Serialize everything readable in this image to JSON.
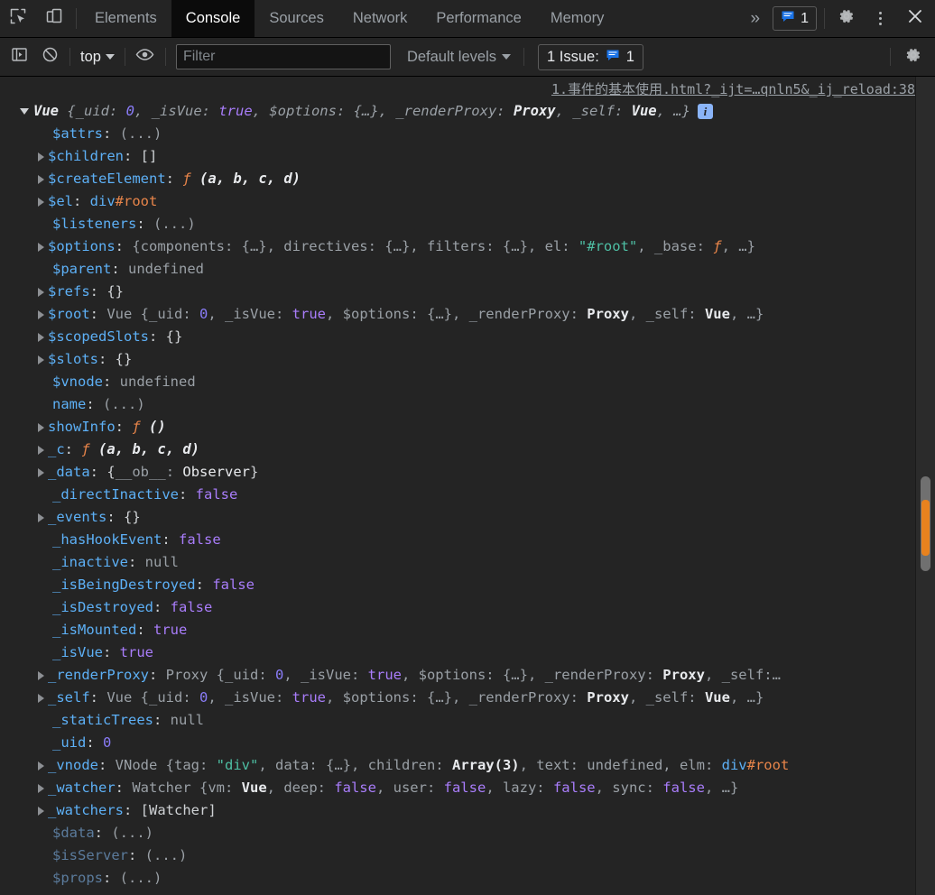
{
  "window": {
    "title": "Chrome DevTools",
    "theme": "dark"
  },
  "tabbar": {
    "inspect_icon": "inspect-element-icon",
    "device_icon": "device-toolbar-icon",
    "tabs": [
      {
        "label": "Elements",
        "active": false
      },
      {
        "label": "Console",
        "active": true
      },
      {
        "label": "Sources",
        "active": false
      },
      {
        "label": "Network",
        "active": false
      },
      {
        "label": "Performance",
        "active": false
      },
      {
        "label": "Memory",
        "active": false
      }
    ],
    "more_tabs_label": "»",
    "issues_chip": {
      "icon": "issues-message-icon",
      "count": "1"
    },
    "settings_icon": "gear-icon",
    "more_options_icon": "kebab-menu-icon",
    "close_icon": "close-icon"
  },
  "filterbar": {
    "sidebar_toggle_icon": "console-sidebar-icon",
    "clear_icon": "clear-console-icon",
    "context": {
      "value": "top"
    },
    "eye_icon": "live-expression-icon",
    "filter": {
      "placeholder": "Filter",
      "value": ""
    },
    "levels": {
      "value": "Default levels"
    },
    "issue_badge": {
      "label": "1 Issue:",
      "icon": "issues-message-icon",
      "count": "1"
    },
    "settings_icon": "console-settings-icon"
  },
  "console": {
    "source_link": "1.事件的基本使用.html?_ijt=…qnln5&_ij_reload:38",
    "info_badge": "i",
    "header": {
      "tokens": [
        {
          "t": "Vue ",
          "c": "t-ital-w"
        },
        {
          "t": "{_uid: ",
          "c": "t-ital"
        },
        {
          "t": "0",
          "c": "t-ital-b"
        },
        {
          "t": ", _isVue: ",
          "c": "t-ital"
        },
        {
          "t": "true",
          "c": "t-ital-p"
        },
        {
          "t": ", $options: {…}, _renderProxy: ",
          "c": "t-ital"
        },
        {
          "t": "Proxy",
          "c": "t-ital-w"
        },
        {
          "t": ", _self: ",
          "c": "t-ital"
        },
        {
          "t": "Vue",
          "c": "t-ital-w"
        },
        {
          "t": ", …}",
          "c": "t-ital"
        }
      ]
    },
    "rows": [
      {
        "arrow": "none",
        "key": "$attrs",
        "keyclass": "k-prop",
        "tokens": [
          {
            "t": ": ",
            "c": "t-punc"
          },
          {
            "t": "(...)",
            "c": "t-dim"
          }
        ]
      },
      {
        "arrow": "closed",
        "key": "$children",
        "keyclass": "k-prop",
        "tokens": [
          {
            "t": ": ",
            "c": "t-punc"
          },
          {
            "t": "[]",
            "c": "t-punc"
          }
        ]
      },
      {
        "arrow": "closed",
        "key": "$createElement",
        "keyclass": "k-prop",
        "tokens": [
          {
            "t": ": ",
            "c": "t-punc"
          },
          {
            "t": "ƒ ",
            "c": "t-fn"
          },
          {
            "t": "(a, b, c, d)",
            "c": "t-ital-w"
          }
        ]
      },
      {
        "arrow": "closed",
        "key": "$el",
        "keyclass": "k-prop",
        "tokens": [
          {
            "t": ": ",
            "c": "t-punc"
          },
          {
            "t": "div",
            "c": "t-node"
          },
          {
            "t": "#root",
            "c": "t-nodeid"
          }
        ]
      },
      {
        "arrow": "none",
        "key": "$listeners",
        "keyclass": "k-prop",
        "tokens": [
          {
            "t": ": ",
            "c": "t-punc"
          },
          {
            "t": "(...)",
            "c": "t-dim"
          }
        ]
      },
      {
        "arrow": "closed",
        "key": "$options",
        "keyclass": "k-prop",
        "tokens": [
          {
            "t": ": ",
            "c": "t-punc"
          },
          {
            "t": "{components: {…}, directives: {…}, filters: {…}, el: ",
            "c": "t-dim"
          },
          {
            "t": "\"#root\"",
            "c": "t-str"
          },
          {
            "t": ", _base: ",
            "c": "t-dim"
          },
          {
            "t": "ƒ",
            "c": "t-fn"
          },
          {
            "t": ", …}",
            "c": "t-dim"
          }
        ]
      },
      {
        "arrow": "none",
        "key": "$parent",
        "keyclass": "k-prop",
        "tokens": [
          {
            "t": ": ",
            "c": "t-punc"
          },
          {
            "t": "undefined",
            "c": "t-dim"
          }
        ]
      },
      {
        "arrow": "closed",
        "key": "$refs",
        "keyclass": "k-prop",
        "tokens": [
          {
            "t": ": ",
            "c": "t-punc"
          },
          {
            "t": "{}",
            "c": "t-punc"
          }
        ]
      },
      {
        "arrow": "closed",
        "key": "$root",
        "keyclass": "k-prop",
        "tokens": [
          {
            "t": ": ",
            "c": "t-punc"
          },
          {
            "t": "Vue ",
            "c": "t-dim"
          },
          {
            "t": "{_uid: ",
            "c": "t-dim"
          },
          {
            "t": "0",
            "c": "t-num"
          },
          {
            "t": ", _isVue: ",
            "c": "t-dim"
          },
          {
            "t": "true",
            "c": "t-bool"
          },
          {
            "t": ", $options: {…}, _renderProxy: ",
            "c": "t-dim"
          },
          {
            "t": "Proxy",
            "c": "t-ctor"
          },
          {
            "t": ", _self: ",
            "c": "t-dim"
          },
          {
            "t": "Vue",
            "c": "t-ctor"
          },
          {
            "t": ", …}",
            "c": "t-dim"
          }
        ]
      },
      {
        "arrow": "closed",
        "key": "$scopedSlots",
        "keyclass": "k-prop",
        "tokens": [
          {
            "t": ": ",
            "c": "t-punc"
          },
          {
            "t": "{}",
            "c": "t-punc"
          }
        ]
      },
      {
        "arrow": "closed",
        "key": "$slots",
        "keyclass": "k-prop",
        "tokens": [
          {
            "t": ": ",
            "c": "t-punc"
          },
          {
            "t": "{}",
            "c": "t-punc"
          }
        ]
      },
      {
        "arrow": "none",
        "key": "$vnode",
        "keyclass": "k-prop",
        "tokens": [
          {
            "t": ": ",
            "c": "t-punc"
          },
          {
            "t": "undefined",
            "c": "t-dim"
          }
        ]
      },
      {
        "arrow": "none",
        "key": "name",
        "keyclass": "k-prop",
        "tokens": [
          {
            "t": ": ",
            "c": "t-punc"
          },
          {
            "t": "(...)",
            "c": "t-dim"
          }
        ]
      },
      {
        "arrow": "closed",
        "key": "showInfo",
        "keyclass": "k-prop",
        "tokens": [
          {
            "t": ": ",
            "c": "t-punc"
          },
          {
            "t": "ƒ ",
            "c": "t-fn"
          },
          {
            "t": "()",
            "c": "t-ital-w"
          }
        ]
      },
      {
        "arrow": "closed",
        "key": "_c",
        "keyclass": "k-prop",
        "tokens": [
          {
            "t": ": ",
            "c": "t-punc"
          },
          {
            "t": "ƒ ",
            "c": "t-fn"
          },
          {
            "t": "(a, b, c, d)",
            "c": "t-ital-w"
          }
        ]
      },
      {
        "arrow": "closed",
        "key": "_data",
        "keyclass": "k-prop",
        "tokens": [
          {
            "t": ": ",
            "c": "t-punc"
          },
          {
            "t": "{",
            "c": "t-punc"
          },
          {
            "t": "__ob__",
            "c": "t-dim"
          },
          {
            "t": ": ",
            "c": "t-dim"
          },
          {
            "t": "Observer",
            "c": "t-white"
          },
          {
            "t": "}",
            "c": "t-punc"
          }
        ]
      },
      {
        "arrow": "none",
        "key": "_directInactive",
        "keyclass": "k-prop",
        "tokens": [
          {
            "t": ": ",
            "c": "t-punc"
          },
          {
            "t": "false",
            "c": "t-bool"
          }
        ]
      },
      {
        "arrow": "closed",
        "key": "_events",
        "keyclass": "k-prop",
        "tokens": [
          {
            "t": ": ",
            "c": "t-punc"
          },
          {
            "t": "{}",
            "c": "t-punc"
          }
        ]
      },
      {
        "arrow": "none",
        "key": "_hasHookEvent",
        "keyclass": "k-prop",
        "tokens": [
          {
            "t": ": ",
            "c": "t-punc"
          },
          {
            "t": "false",
            "c": "t-bool"
          }
        ]
      },
      {
        "arrow": "none",
        "key": "_inactive",
        "keyclass": "k-prop",
        "tokens": [
          {
            "t": ": ",
            "c": "t-punc"
          },
          {
            "t": "null",
            "c": "t-dim"
          }
        ]
      },
      {
        "arrow": "none",
        "key": "_isBeingDestroyed",
        "keyclass": "k-prop",
        "tokens": [
          {
            "t": ": ",
            "c": "t-punc"
          },
          {
            "t": "false",
            "c": "t-bool"
          }
        ]
      },
      {
        "arrow": "none",
        "key": "_isDestroyed",
        "keyclass": "k-prop",
        "tokens": [
          {
            "t": ": ",
            "c": "t-punc"
          },
          {
            "t": "false",
            "c": "t-bool"
          }
        ]
      },
      {
        "arrow": "none",
        "key": "_isMounted",
        "keyclass": "k-prop",
        "tokens": [
          {
            "t": ": ",
            "c": "t-punc"
          },
          {
            "t": "true",
            "c": "t-bool"
          }
        ]
      },
      {
        "arrow": "none",
        "key": "_isVue",
        "keyclass": "k-prop",
        "tokens": [
          {
            "t": ": ",
            "c": "t-punc"
          },
          {
            "t": "true",
            "c": "t-bool"
          }
        ]
      },
      {
        "arrow": "closed",
        "key": "_renderProxy",
        "keyclass": "k-prop",
        "tokens": [
          {
            "t": ": ",
            "c": "t-punc"
          },
          {
            "t": "Proxy ",
            "c": "t-dim"
          },
          {
            "t": "{_uid: ",
            "c": "t-dim"
          },
          {
            "t": "0",
            "c": "t-num"
          },
          {
            "t": ", _isVue: ",
            "c": "t-dim"
          },
          {
            "t": "true",
            "c": "t-bool"
          },
          {
            "t": ", $options: {…}, _renderProxy: ",
            "c": "t-dim"
          },
          {
            "t": "Proxy",
            "c": "t-ctor"
          },
          {
            "t": ", _self:…",
            "c": "t-dim"
          }
        ]
      },
      {
        "arrow": "closed",
        "key": "_self",
        "keyclass": "k-prop",
        "tokens": [
          {
            "t": ": ",
            "c": "t-punc"
          },
          {
            "t": "Vue ",
            "c": "t-dim"
          },
          {
            "t": "{_uid: ",
            "c": "t-dim"
          },
          {
            "t": "0",
            "c": "t-num"
          },
          {
            "t": ", _isVue: ",
            "c": "t-dim"
          },
          {
            "t": "true",
            "c": "t-bool"
          },
          {
            "t": ", $options: {…}, _renderProxy: ",
            "c": "t-dim"
          },
          {
            "t": "Proxy",
            "c": "t-ctor"
          },
          {
            "t": ", _self: ",
            "c": "t-dim"
          },
          {
            "t": "Vue",
            "c": "t-ctor"
          },
          {
            "t": ", …}",
            "c": "t-dim"
          }
        ]
      },
      {
        "arrow": "none",
        "key": "_staticTrees",
        "keyclass": "k-prop",
        "tokens": [
          {
            "t": ": ",
            "c": "t-punc"
          },
          {
            "t": "null",
            "c": "t-dim"
          }
        ]
      },
      {
        "arrow": "none",
        "key": "_uid",
        "keyclass": "k-prop",
        "tokens": [
          {
            "t": ": ",
            "c": "t-punc"
          },
          {
            "t": "0",
            "c": "t-num"
          }
        ]
      },
      {
        "arrow": "closed",
        "key": "_vnode",
        "keyclass": "k-prop",
        "tokens": [
          {
            "t": ": ",
            "c": "t-punc"
          },
          {
            "t": "VNode ",
            "c": "t-dim"
          },
          {
            "t": "{tag: ",
            "c": "t-dim"
          },
          {
            "t": "\"div\"",
            "c": "t-str"
          },
          {
            "t": ", data: {…}, children: ",
            "c": "t-dim"
          },
          {
            "t": "Array(3)",
            "c": "t-ctor"
          },
          {
            "t": ", text: ",
            "c": "t-dim"
          },
          {
            "t": "undefined",
            "c": "t-dim"
          },
          {
            "t": ", elm: ",
            "c": "t-dim"
          },
          {
            "t": "div",
            "c": "t-node"
          },
          {
            "t": "#root",
            "c": "t-nodeid"
          }
        ]
      },
      {
        "arrow": "closed",
        "key": "_watcher",
        "keyclass": "k-prop",
        "tokens": [
          {
            "t": ": ",
            "c": "t-punc"
          },
          {
            "t": "Watcher ",
            "c": "t-dim"
          },
          {
            "t": "{vm: ",
            "c": "t-dim"
          },
          {
            "t": "Vue",
            "c": "t-ctor"
          },
          {
            "t": ", deep: ",
            "c": "t-dim"
          },
          {
            "t": "false",
            "c": "t-bool"
          },
          {
            "t": ", user: ",
            "c": "t-dim"
          },
          {
            "t": "false",
            "c": "t-bool"
          },
          {
            "t": ", lazy: ",
            "c": "t-dim"
          },
          {
            "t": "false",
            "c": "t-bool"
          },
          {
            "t": ", sync: ",
            "c": "t-dim"
          },
          {
            "t": "false",
            "c": "t-bool"
          },
          {
            "t": ", …}",
            "c": "t-dim"
          }
        ]
      },
      {
        "arrow": "closed",
        "key": "_watchers",
        "keyclass": "k-prop",
        "tokens": [
          {
            "t": ": ",
            "c": "t-punc"
          },
          {
            "t": "[Watcher]",
            "c": "t-punc"
          }
        ]
      },
      {
        "arrow": "none",
        "key": "$data",
        "keyclass": "k-prop-dim",
        "tokens": [
          {
            "t": ": ",
            "c": "t-punc"
          },
          {
            "t": "(...)",
            "c": "t-dim"
          }
        ]
      },
      {
        "arrow": "none",
        "key": "$isServer",
        "keyclass": "k-prop-dim",
        "tokens": [
          {
            "t": ": ",
            "c": "t-punc"
          },
          {
            "t": "(...)",
            "c": "t-dim"
          }
        ]
      },
      {
        "arrow": "none",
        "key": "$props",
        "keyclass": "k-prop-dim",
        "tokens": [
          {
            "t": ": ",
            "c": "t-punc"
          },
          {
            "t": "(...)",
            "c": "t-dim"
          }
        ]
      }
    ]
  },
  "colors": {
    "accent_blue": "#1a73e8",
    "issue_orange": "#e8821e",
    "background": "#242424",
    "active_tab_bg": "#0b0b0b"
  }
}
